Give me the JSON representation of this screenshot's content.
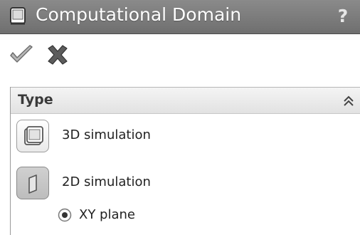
{
  "window": {
    "title": "Computational Domain",
    "help_label": "?"
  },
  "actions": {
    "ok_icon": "checkmark-icon",
    "cancel_icon": "x-icon"
  },
  "type_group": {
    "title": "Type",
    "collapse_icon": "double-chevron-up-icon",
    "options": [
      {
        "label": "3D simulation",
        "icon": "cube-icon",
        "selected": false
      },
      {
        "label": "2D simulation",
        "icon": "plane-icon",
        "selected": true
      }
    ],
    "plane": {
      "label": "XY plane",
      "checked": true
    }
  },
  "colors": {
    "titlebar": "#7d7d7d",
    "title_text": "#ffffff",
    "header_bg": "#e8e8e8"
  }
}
